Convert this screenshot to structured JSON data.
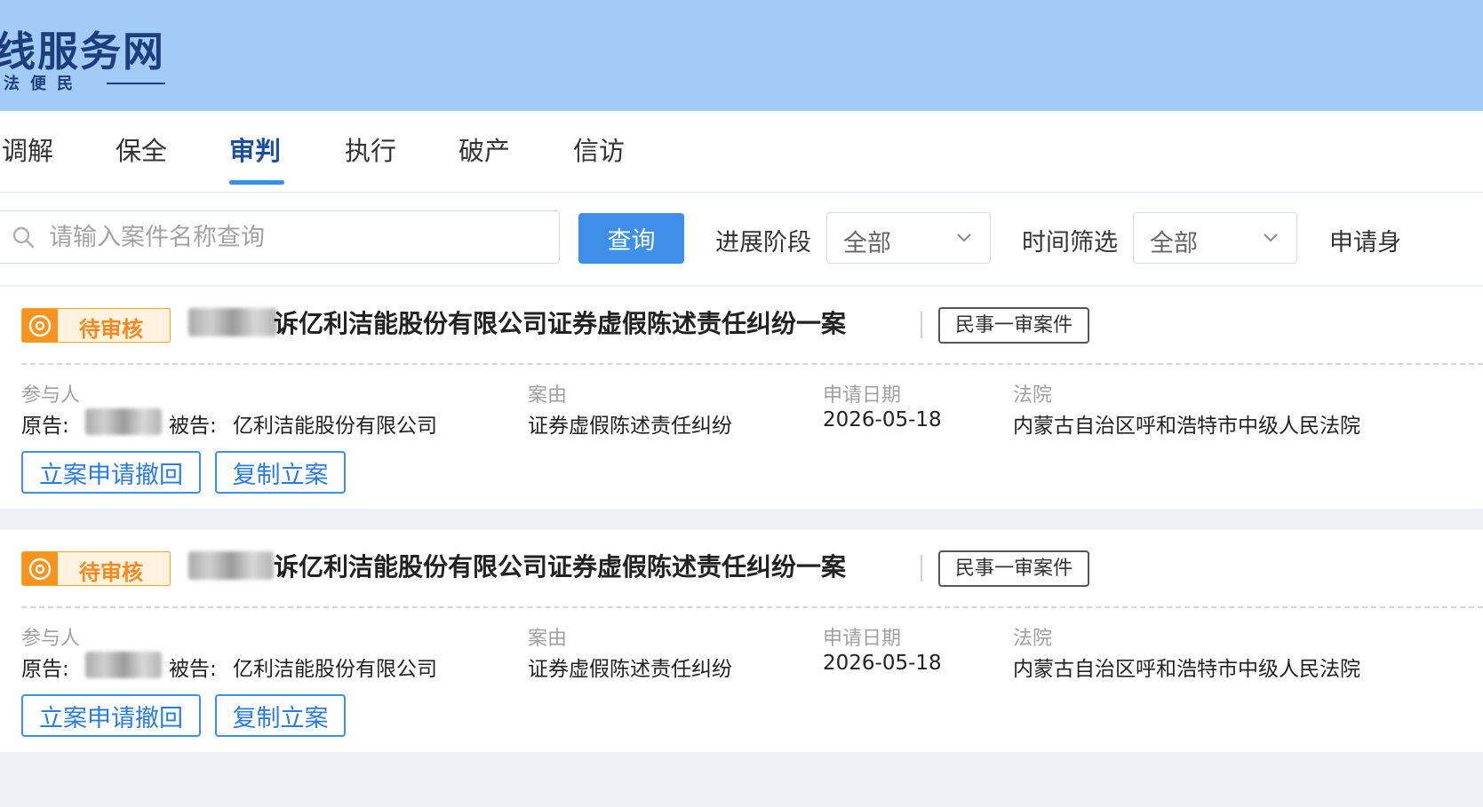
{
  "header": {
    "brand_title": "线服务网",
    "slogan": "法便民"
  },
  "tabs": [
    {
      "label": "调解"
    },
    {
      "label": "保全"
    },
    {
      "label": "审判",
      "active": true
    },
    {
      "label": "执行"
    },
    {
      "label": "破产"
    },
    {
      "label": "信访"
    }
  ],
  "filters": {
    "search_placeholder": "请输入案件名称查询",
    "query_label": "查询",
    "stage_label": "进展阶段",
    "stage_value": "全部",
    "time_label": "时间筛选",
    "time_value": "全部",
    "apply_label": "申请身"
  },
  "cases": [
    {
      "status": "待审核",
      "title": "诉亿利洁能股份有限公司证券虚假陈述责任纠纷一案",
      "type": "民事一审案件",
      "labels": {
        "party": "参与人",
        "cause": "案由",
        "date": "申请日期",
        "court": "法院"
      },
      "plaintiff_label": "原告:",
      "defendant_label": "被告:",
      "defendant": "亿利洁能股份有限公司",
      "cause": "证券虚假陈述责任纠纷",
      "date": "2026-05-18",
      "court": "内蒙古自治区呼和浩特市中级人民法院",
      "withdraw_label": "立案申请撤回",
      "copy_label": "复制立案"
    },
    {
      "status": "待审核",
      "title": "诉亿利洁能股份有限公司证券虚假陈述责任纠纷一案",
      "type": "民事一审案件",
      "labels": {
        "party": "参与人",
        "cause": "案由",
        "date": "申请日期",
        "court": "法院"
      },
      "plaintiff_label": "原告:",
      "defendant_label": "被告:",
      "defendant": "亿利洁能股份有限公司",
      "cause": "证券虚假陈述责任纠纷",
      "date": "2026-05-18",
      "court": "内蒙古自治区呼和浩特市中级人民法院",
      "withdraw_label": "立案申请撤回",
      "copy_label": "复制立案"
    }
  ],
  "colors": {
    "header_bg": "#a3cbf7",
    "brand": "#1c3f7c",
    "accent": "#3d8fe8",
    "status": "#f7931e"
  },
  "icons": [
    "search-icon",
    "chevron-down-icon",
    "pending-clock-icon"
  ]
}
